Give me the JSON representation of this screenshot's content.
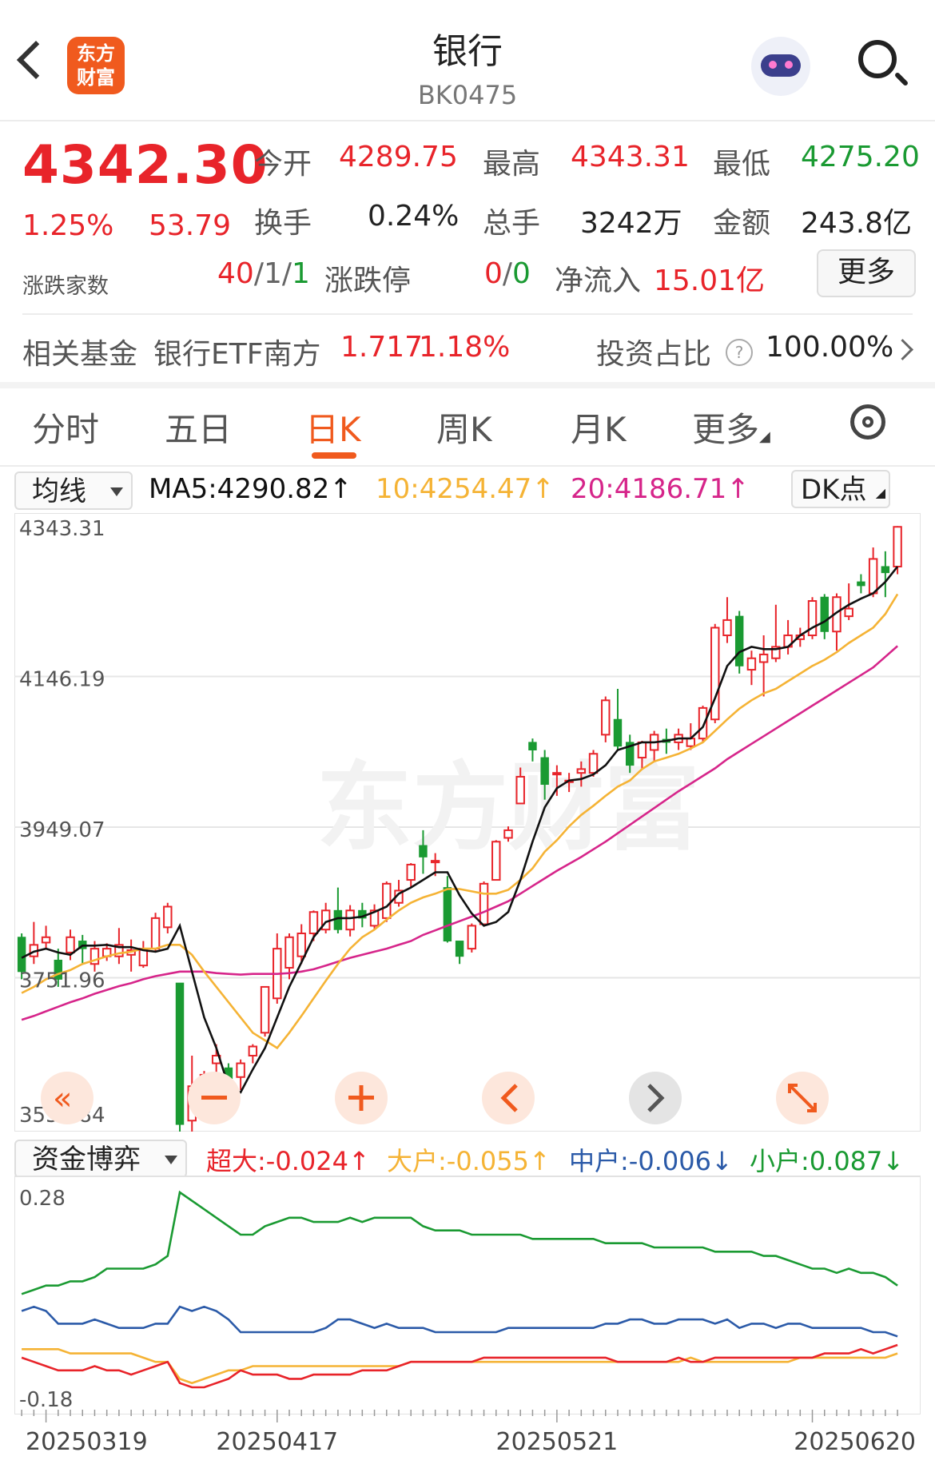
{
  "header": {
    "logo_text": "东方\n财富",
    "title": "银行",
    "code": "BK0475"
  },
  "quote": {
    "price": "4342.30",
    "change_pct": "1.25%",
    "change": "53.79",
    "open_label": "今开",
    "open": "4289.75",
    "high_label": "最高",
    "high": "4343.31",
    "low_label": "最低",
    "low": "4275.20",
    "turnover_label": "换手",
    "turnover": "0.24%",
    "volume_label": "总手",
    "volume": "3242万",
    "amount_label": "金额",
    "amount": "243.8亿",
    "breadth_label": "涨跌家数",
    "breadth_up": "40",
    "breadth_flat": "1",
    "breadth_down": "1",
    "limit_label": "涨跌停",
    "limit_up": "0",
    "limit_down": "0",
    "netflow_label": "净流入",
    "netflow": "15.01亿",
    "more_label": "更多"
  },
  "fund": {
    "label": "相关基金",
    "name": "银行ETF南方",
    "price": "1.717",
    "pct": "1.18%",
    "ratio_label": "投资占比",
    "ratio": "100.00%"
  },
  "tabs": [
    "分时",
    "五日",
    "日K",
    "周K",
    "月K",
    "更多"
  ],
  "ma": {
    "selector": "均线",
    "ma5": "MA5:4290.82↑",
    "ma10": "10:4254.47↑",
    "ma20": "20:4186.71↑",
    "dk": "DK点"
  },
  "flow_legend": {
    "selector": "资金博弈",
    "super": "超大:-0.024↑",
    "big": "大户:-0.055↑",
    "mid": "中户:-0.006↓",
    "small": "小户:0.087↓"
  },
  "colors": {
    "up": "#e8242a",
    "down": "#1a9a32",
    "accent": "#f05a1e",
    "ma5": "#111111",
    "ma10": "#f5b335",
    "ma20": "#d6258a",
    "mid": "#2b5aa8"
  },
  "chart_data": [
    {
      "type": "candlestick",
      "y_ticks": [
        "4343.31",
        "4146.19",
        "3949.07",
        "3751.96",
        "3554.84"
      ],
      "ylim": [
        3554.84,
        4343.31
      ],
      "x": [
        "20250319",
        "20250417",
        "20250521",
        "20250620"
      ],
      "x_tick_index": [
        2,
        21,
        44,
        65
      ],
      "candles": [
        [
          3805,
          3760,
          3810,
          3750
        ],
        [
          3780,
          3795,
          3825,
          3770
        ],
        [
          3798,
          3805,
          3820,
          3790
        ],
        [
          3775,
          3750,
          3790,
          3740
        ],
        [
          3785,
          3805,
          3815,
          3775
        ],
        [
          3800,
          3790,
          3808,
          3770
        ],
        [
          3770,
          3790,
          3800,
          3760
        ],
        [
          3780,
          3790,
          3797,
          3774
        ],
        [
          3780,
          3795,
          3817,
          3770
        ],
        [
          3782,
          3788,
          3802,
          3760
        ],
        [
          3768,
          3790,
          3800,
          3765
        ],
        [
          3790,
          3830,
          3837,
          3785
        ],
        [
          3818,
          3845,
          3850,
          3810
        ],
        [
          3745,
          3560,
          3745,
          3544
        ],
        [
          3565,
          3610,
          3650,
          3545
        ],
        [
          3610,
          3625,
          3630,
          3570
        ],
        [
          3640,
          3650,
          3665,
          3628
        ],
        [
          3634,
          3620,
          3640,
          3612
        ],
        [
          3622,
          3640,
          3645,
          3605
        ],
        [
          3650,
          3662,
          3665,
          3640
        ],
        [
          3680,
          3740,
          3740,
          3675
        ],
        [
          3725,
          3790,
          3810,
          3718
        ],
        [
          3765,
          3805,
          3810,
          3750
        ],
        [
          3780,
          3810,
          3822,
          3770
        ],
        [
          3810,
          3838,
          3840,
          3800
        ],
        [
          3815,
          3840,
          3850,
          3810
        ],
        [
          3840,
          3815,
          3870,
          3810
        ],
        [
          3815,
          3840,
          3847,
          3806
        ],
        [
          3840,
          3830,
          3850,
          3818
        ],
        [
          3820,
          3840,
          3848,
          3815
        ],
        [
          3830,
          3875,
          3878,
          3825
        ],
        [
          3850,
          3866,
          3880,
          3845
        ],
        [
          3880,
          3900,
          3902,
          3870
        ],
        [
          3925,
          3910,
          3945,
          3888
        ],
        [
          3905,
          3905,
          3915,
          3885
        ],
        [
          3870,
          3800,
          3885,
          3798
        ],
        [
          3800,
          3780,
          3800,
          3770
        ],
        [
          3790,
          3820,
          3823,
          3785
        ],
        [
          3822,
          3875,
          3878,
          3819
        ],
        [
          3880,
          3930,
          3932,
          3879
        ],
        [
          3935,
          3945,
          3950,
          3930
        ],
        [
          3980,
          4015,
          4027,
          4015
        ],
        [
          4060,
          4050,
          4065,
          4035
        ],
        [
          4040,
          4005,
          4050,
          3985
        ],
        [
          4020,
          4020,
          4030,
          3990
        ],
        [
          4010,
          4010,
          4020,
          3995
        ],
        [
          4020,
          4025,
          4035,
          4002
        ],
        [
          4020,
          4045,
          4050,
          4015
        ],
        [
          4070,
          4115,
          4120,
          4060
        ],
        [
          4090,
          4055,
          4130,
          4050
        ],
        [
          4060,
          4030,
          4070,
          4020
        ],
        [
          4040,
          4060,
          4062,
          4025
        ],
        [
          4050,
          4070,
          4075,
          4035
        ],
        [
          4064,
          4060,
          4078,
          4045
        ],
        [
          4060,
          4070,
          4078,
          4050
        ],
        [
          4055,
          4065,
          4085,
          4050
        ],
        [
          4065,
          4105,
          4108,
          4060
        ],
        [
          4090,
          4210,
          4215,
          4085
        ],
        [
          4200,
          4220,
          4250,
          4190
        ],
        [
          4225,
          4160,
          4232,
          4150
        ],
        [
          4155,
          4170,
          4180,
          4135
        ],
        [
          4165,
          4175,
          4200,
          4120
        ],
        [
          4170,
          4185,
          4240,
          4165
        ],
        [
          4185,
          4200,
          4220,
          4175
        ],
        [
          4195,
          4200,
          4210,
          4185
        ],
        [
          4200,
          4245,
          4250,
          4195
        ],
        [
          4250,
          4205,
          4254,
          4195
        ],
        [
          4205,
          4250,
          4255,
          4180
        ],
        [
          4225,
          4235,
          4268,
          4220
        ],
        [
          4270,
          4265,
          4280,
          4255
        ],
        [
          4255,
          4300,
          4315,
          4250
        ],
        [
          4290,
          4282,
          4310,
          4250
        ],
        [
          4290,
          4342,
          4343,
          4280
        ]
      ],
      "ma5": [
        3778,
        3786,
        3790,
        3785,
        3782,
        3794,
        3794,
        3795,
        3792,
        3792,
        3788,
        3786,
        3790,
        3820,
        3760,
        3700,
        3660,
        3610,
        3602,
        3632,
        3660,
        3700,
        3740,
        3772,
        3805,
        3825,
        3830,
        3830,
        3832,
        3838,
        3845,
        3862,
        3870,
        3880,
        3890,
        3890,
        3860,
        3836,
        3820,
        3825,
        3838,
        3880,
        3930,
        3975,
        4000,
        4010,
        4012,
        4018,
        4030,
        4050,
        4055,
        4060,
        4060,
        4062,
        4065,
        4065,
        4080,
        4118,
        4160,
        4178,
        4185,
        4182,
        4182,
        4185,
        4200,
        4210,
        4218,
        4230,
        4240,
        4248,
        4255,
        4270,
        4290
      ],
      "ma10": [
        3732,
        3740,
        3750,
        3757,
        3762,
        3770,
        3775,
        3780,
        3784,
        3786,
        3790,
        3790,
        3795,
        3795,
        3782,
        3760,
        3740,
        3720,
        3700,
        3680,
        3670,
        3660,
        3680,
        3702,
        3725,
        3748,
        3770,
        3790,
        3805,
        3815,
        3828,
        3840,
        3850,
        3857,
        3862,
        3868,
        3868,
        3865,
        3862,
        3862,
        3867,
        3880,
        3895,
        3917,
        3932,
        3950,
        3965,
        3977,
        3990,
        4002,
        4010,
        4025,
        4035,
        4040,
        4045,
        4052,
        4060,
        4075,
        4090,
        4104,
        4115,
        4124,
        4130,
        4140,
        4150,
        4160,
        4168,
        4178,
        4190,
        4200,
        4210,
        4228,
        4254
      ],
      "ma20": [
        3697,
        3702,
        3708,
        3714,
        3720,
        3725,
        3731,
        3736,
        3741,
        3745,
        3750,
        3754,
        3757,
        3760,
        3760,
        3760,
        3758,
        3757,
        3756,
        3757,
        3757,
        3757,
        3758,
        3760,
        3763,
        3768,
        3773,
        3778,
        3782,
        3786,
        3790,
        3795,
        3800,
        3808,
        3814,
        3820,
        3826,
        3832,
        3838,
        3845,
        3852,
        3862,
        3872,
        3882,
        3892,
        3901,
        3910,
        3920,
        3930,
        3941,
        3952,
        3963,
        3974,
        3985,
        3996,
        4006,
        4016,
        4026,
        4038,
        4048,
        4058,
        4068,
        4078,
        4088,
        4098,
        4108,
        4118,
        4128,
        4138,
        4148,
        4158,
        4172,
        4186
      ]
    },
    {
      "type": "line",
      "y_ticks": [
        "0.28",
        "-0.18"
      ],
      "ylim": [
        -0.18,
        0.28
      ],
      "series": [
        {
          "color": "#1a9a32",
          "values": [
            0.04,
            0.05,
            0.06,
            0.06,
            0.07,
            0.07,
            0.08,
            0.1,
            0.1,
            0.1,
            0.1,
            0.11,
            0.13,
            0.28,
            0.26,
            0.24,
            0.22,
            0.2,
            0.18,
            0.18,
            0.2,
            0.21,
            0.22,
            0.22,
            0.21,
            0.21,
            0.21,
            0.22,
            0.21,
            0.22,
            0.22,
            0.22,
            0.22,
            0.2,
            0.19,
            0.19,
            0.19,
            0.18,
            0.18,
            0.18,
            0.18,
            0.18,
            0.17,
            0.17,
            0.17,
            0.17,
            0.17,
            0.17,
            0.16,
            0.16,
            0.16,
            0.16,
            0.15,
            0.15,
            0.15,
            0.15,
            0.15,
            0.14,
            0.14,
            0.14,
            0.14,
            0.13,
            0.13,
            0.12,
            0.11,
            0.1,
            0.1,
            0.09,
            0.1,
            0.09,
            0.09,
            0.08,
            0.06
          ]
        },
        {
          "color": "#2b5aa8",
          "values": [
            0.0,
            0.01,
            0.0,
            -0.03,
            -0.03,
            -0.03,
            -0.02,
            -0.03,
            -0.04,
            -0.04,
            -0.04,
            -0.03,
            -0.03,
            0.01,
            0.0,
            0.01,
            0.0,
            -0.02,
            -0.05,
            -0.05,
            -0.05,
            -0.05,
            -0.05,
            -0.05,
            -0.05,
            -0.04,
            -0.02,
            -0.02,
            -0.03,
            -0.04,
            -0.03,
            -0.04,
            -0.04,
            -0.04,
            -0.05,
            -0.05,
            -0.05,
            -0.05,
            -0.05,
            -0.05,
            -0.04,
            -0.04,
            -0.04,
            -0.04,
            -0.04,
            -0.04,
            -0.04,
            -0.04,
            -0.03,
            -0.03,
            -0.02,
            -0.02,
            -0.03,
            -0.03,
            -0.02,
            -0.02,
            -0.02,
            -0.03,
            -0.02,
            -0.04,
            -0.03,
            -0.03,
            -0.04,
            -0.03,
            -0.03,
            -0.04,
            -0.04,
            -0.04,
            -0.04,
            -0.04,
            -0.05,
            -0.05,
            -0.06
          ]
        },
        {
          "color": "#f5b335",
          "values": [
            -0.09,
            -0.09,
            -0.09,
            -0.09,
            -0.1,
            -0.1,
            -0.1,
            -0.1,
            -0.1,
            -0.1,
            -0.11,
            -0.12,
            -0.12,
            -0.16,
            -0.17,
            -0.16,
            -0.15,
            -0.14,
            -0.14,
            -0.13,
            -0.13,
            -0.13,
            -0.13,
            -0.13,
            -0.13,
            -0.13,
            -0.13,
            -0.13,
            -0.13,
            -0.13,
            -0.13,
            -0.13,
            -0.12,
            -0.12,
            -0.12,
            -0.12,
            -0.12,
            -0.12,
            -0.12,
            -0.12,
            -0.12,
            -0.12,
            -0.12,
            -0.12,
            -0.12,
            -0.12,
            -0.12,
            -0.12,
            -0.12,
            -0.12,
            -0.12,
            -0.12,
            -0.12,
            -0.12,
            -0.12,
            -0.11,
            -0.12,
            -0.12,
            -0.12,
            -0.12,
            -0.12,
            -0.12,
            -0.12,
            -0.12,
            -0.11,
            -0.11,
            -0.11,
            -0.11,
            -0.11,
            -0.11,
            -0.11,
            -0.11,
            -0.1
          ]
        },
        {
          "color": "#e8242a",
          "values": [
            -0.11,
            -0.12,
            -0.13,
            -0.14,
            -0.14,
            -0.14,
            -0.13,
            -0.14,
            -0.14,
            -0.15,
            -0.14,
            -0.13,
            -0.12,
            -0.17,
            -0.18,
            -0.18,
            -0.17,
            -0.16,
            -0.14,
            -0.15,
            -0.15,
            -0.15,
            -0.16,
            -0.16,
            -0.15,
            -0.15,
            -0.15,
            -0.15,
            -0.14,
            -0.14,
            -0.14,
            -0.13,
            -0.12,
            -0.12,
            -0.12,
            -0.12,
            -0.12,
            -0.12,
            -0.11,
            -0.11,
            -0.11,
            -0.11,
            -0.11,
            -0.11,
            -0.11,
            -0.11,
            -0.11,
            -0.11,
            -0.11,
            -0.12,
            -0.12,
            -0.12,
            -0.12,
            -0.12,
            -0.11,
            -0.12,
            -0.12,
            -0.11,
            -0.11,
            -0.11,
            -0.11,
            -0.11,
            -0.11,
            -0.11,
            -0.11,
            -0.11,
            -0.1,
            -0.1,
            -0.1,
            -0.09,
            -0.1,
            -0.09,
            -0.08
          ]
        }
      ]
    }
  ]
}
